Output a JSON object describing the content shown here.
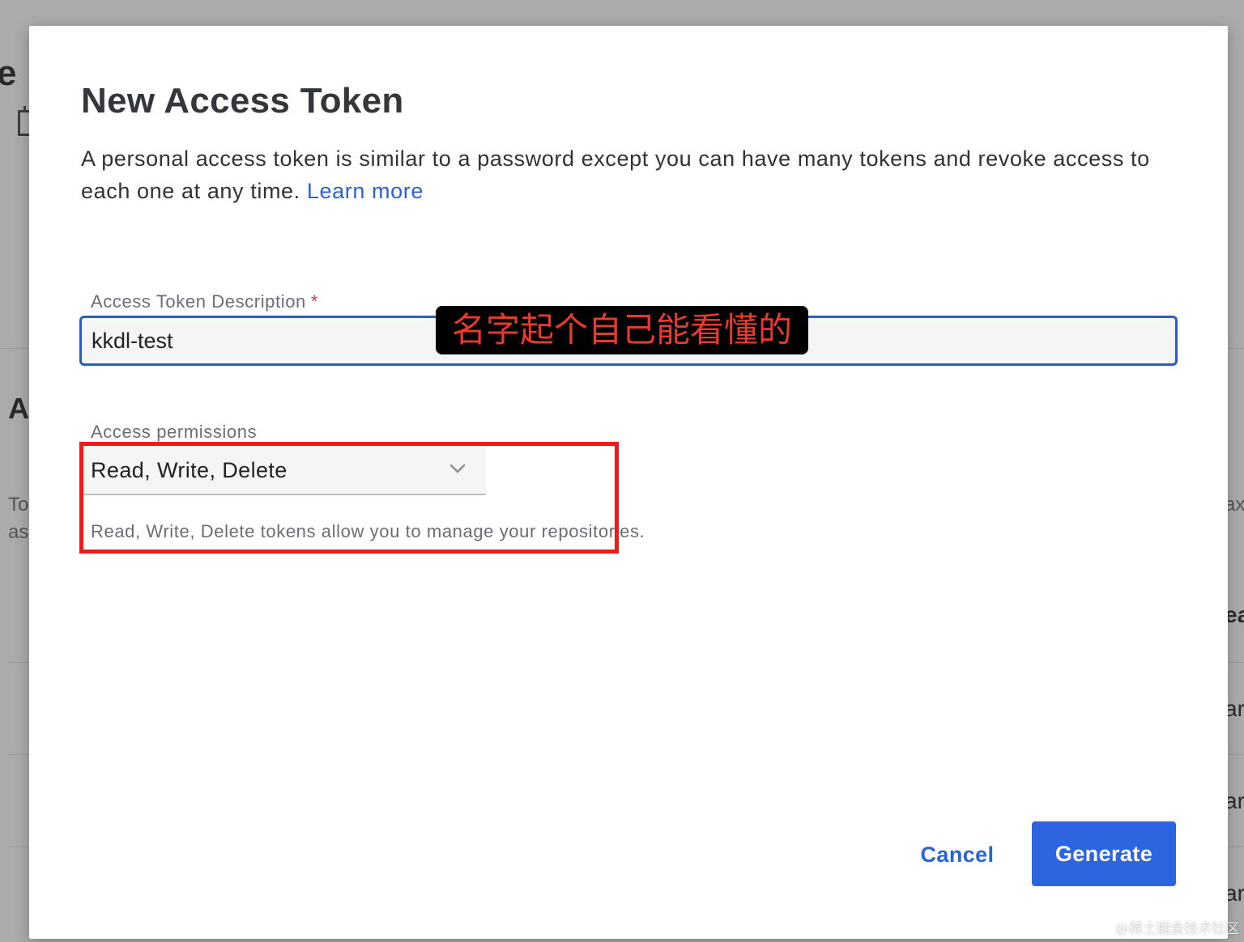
{
  "background": {
    "fragments_left": [
      "e",
      "A",
      "To",
      "as"
    ],
    "fragments_right": [
      "axi",
      "ea",
      "ar",
      "ar",
      "ar"
    ]
  },
  "modal": {
    "title": "New Access Token",
    "description": "A personal access token is similar to a password except you can have many tokens and revoke access to each one at any time.",
    "learn_more": "Learn more",
    "description_field": {
      "label": "Access Token Description",
      "required_marker": "*",
      "value": "kkdl-test"
    },
    "permissions_field": {
      "label": "Access permissions",
      "selected": "Read, Write, Delete",
      "help_text": "Read, Write, Delete tokens allow you to manage your repositories."
    },
    "buttons": {
      "cancel": "Cancel",
      "generate": "Generate"
    }
  },
  "annotation": {
    "text": "名字起个自己能看懂的"
  },
  "watermark": "@稀土掘金技术社区",
  "colors": {
    "accent": "#2d64e0",
    "link": "#2a64d4",
    "focus_border": "#2d5fb8",
    "highlight_box": "#ee1b1b",
    "annotation_text": "#e8392d"
  }
}
